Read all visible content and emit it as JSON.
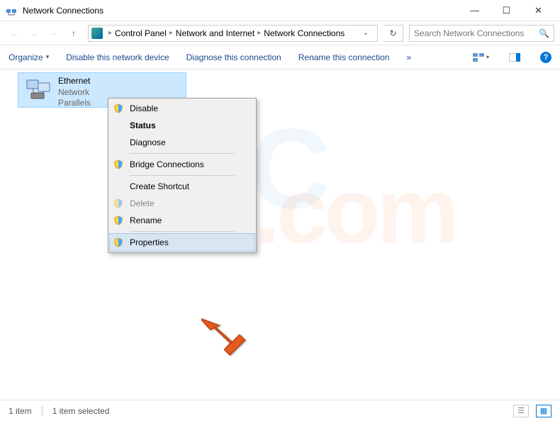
{
  "window": {
    "title": "Network Connections"
  },
  "winbuttons": {
    "min": "—",
    "max": "☐",
    "close": "✕"
  },
  "breadcrumb": {
    "dd": "▸",
    "seg1": "Control Panel",
    "seg2": "Network and Internet",
    "seg3": "Network Connections",
    "dropdown": "⌄",
    "refresh": "↻"
  },
  "search": {
    "placeholder": "Search Network Connections",
    "icon": "🔍"
  },
  "toolbar": {
    "organize": "Organize",
    "disable": "Disable this network device",
    "diagnose": "Diagnose this connection",
    "rename": "Rename this connection",
    "overflow": "»"
  },
  "adapter": {
    "name": "Ethernet",
    "status": "Network",
    "device": "Parallels"
  },
  "context": {
    "disable": "Disable",
    "status": "Status",
    "diagnose": "Diagnose",
    "bridge": "Bridge Connections",
    "shortcut": "Create Shortcut",
    "delete": "Delete",
    "rename": "Rename",
    "properties": "Properties"
  },
  "statusbar": {
    "count": "1 item",
    "selected": "1 item selected"
  }
}
